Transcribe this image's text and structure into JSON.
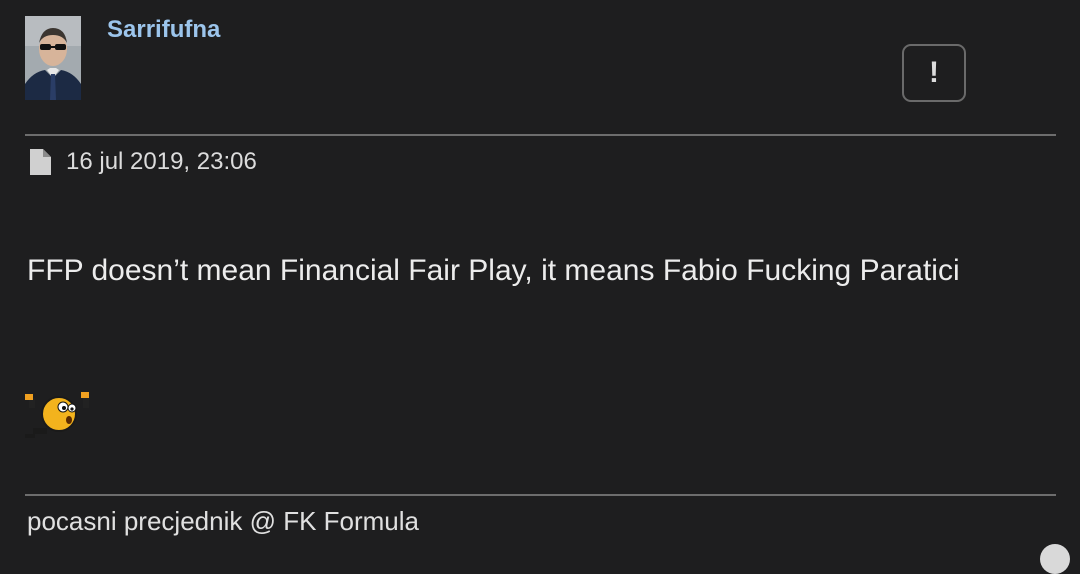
{
  "post": {
    "author": "Sarrifufna",
    "report_label": "!",
    "date": "16 jul 2019, 23:06",
    "body": "FFP doesn’t mean Financial Fair Play, it means Fabio Fucking Paratici",
    "signature": "pocasni precjednik @ FK Formula"
  },
  "icons": {
    "avatar": "avatar-photo",
    "post": "file-icon",
    "emoticon": "flexing-smiley-icon",
    "scroll": "scroll-up-icon"
  },
  "colors": {
    "background": "#1e1e1f",
    "username": "#9cc5ec",
    "divider": "#6d6d6d"
  }
}
